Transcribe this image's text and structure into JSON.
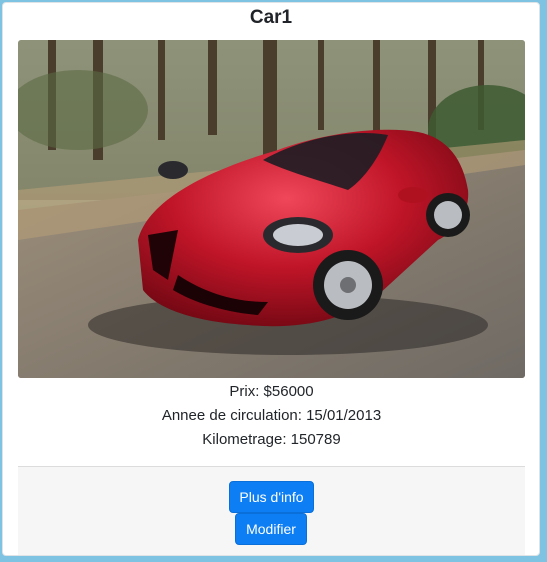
{
  "card": {
    "title": "Car1",
    "image_subject": "red sports car on road",
    "specs": {
      "price": "Prix: $56000",
      "registration": "Annee de circulation: 15/01/2013",
      "mileage": "Kilometrage: 150789"
    },
    "buttons": {
      "more_info": "Plus d'info",
      "edit": "Modifier"
    }
  },
  "colors": {
    "page_background": "#7ec4e2",
    "button_primary": "#0d7ef3",
    "footer_background": "#f6f6f6"
  }
}
